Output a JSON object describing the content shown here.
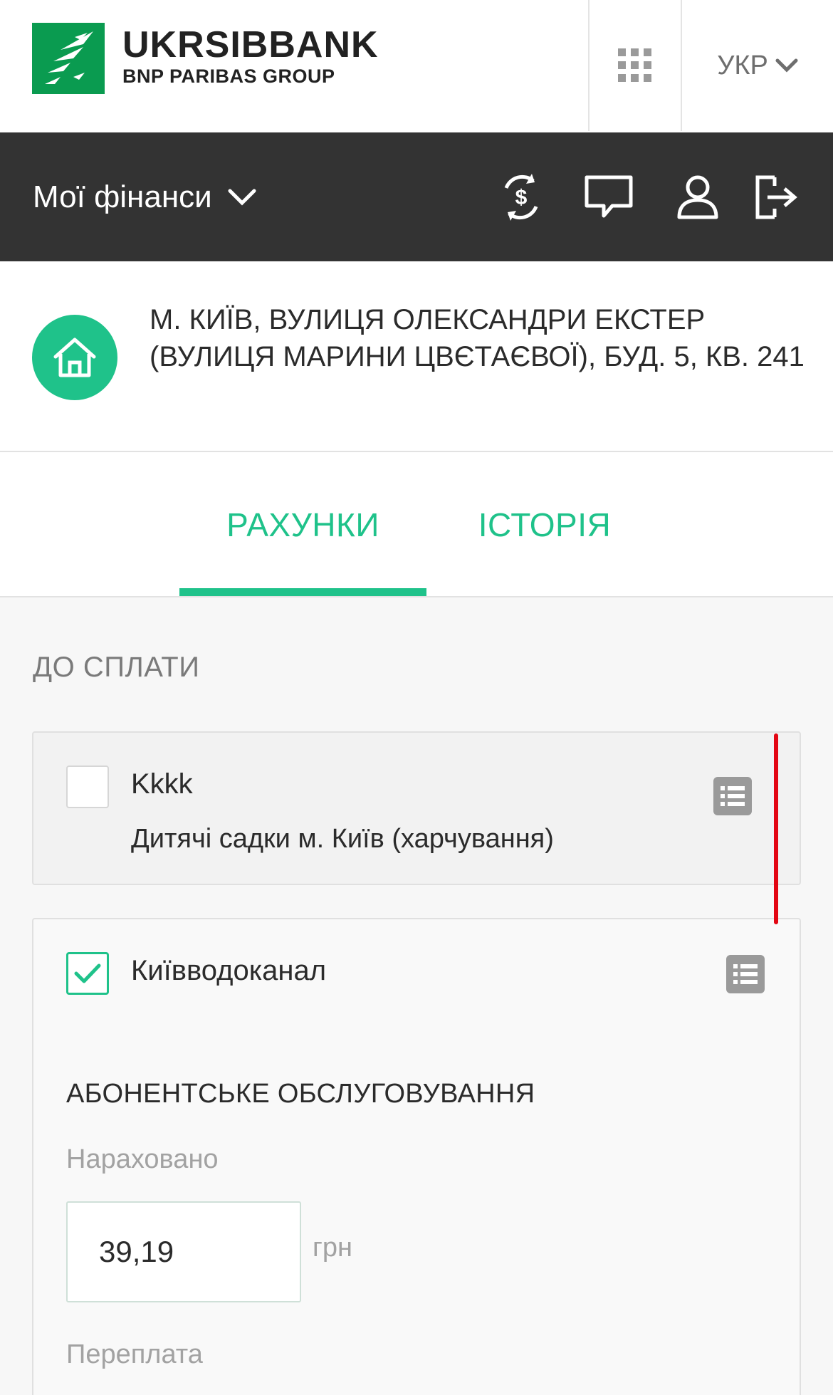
{
  "header": {
    "brand_title": "UKRSIBBANK",
    "brand_subtitle": "BNP PARIBAS GROUP",
    "apps_icon": "grid-icon",
    "language": "УКР"
  },
  "navbar": {
    "title": "Мої фінанси",
    "icons": [
      "currency-exchange-icon",
      "chat-icon",
      "user-icon",
      "logout-icon"
    ]
  },
  "address": {
    "icon": "home-icon",
    "text": "М. КИЇВ, ВУЛИЦЯ ОЛЕКСАНДРИ ЕКСТЕР (ВУЛИЦЯ МАРИНИ ЦВЄТАЄВОЇ), БУД. 5, КВ. 241"
  },
  "tabs": [
    {
      "label": "РАХУНКИ",
      "active": true
    },
    {
      "label": "ІСТОРІЯ",
      "active": false
    }
  ],
  "main": {
    "section_title": "ДО СПЛАТИ",
    "payees": [
      {
        "name": "Kkkk",
        "subtitle": "Дитячі садки м. Київ (харчування)",
        "checked": false
      },
      {
        "name": "Київводоканал",
        "checked": true
      }
    ],
    "service": {
      "title": "АБОНЕНТСЬКЕ ОБСЛУГОВУВАННЯ",
      "charged_label": "Нараховано",
      "charged_value": "39,19",
      "currency": "грн",
      "overpay_label": "Переплата"
    }
  },
  "colors": {
    "accent": "#1fc28a",
    "brand_green": "#0a9b50",
    "navbar_bg": "#333333",
    "annotation_red": "#e30613"
  }
}
